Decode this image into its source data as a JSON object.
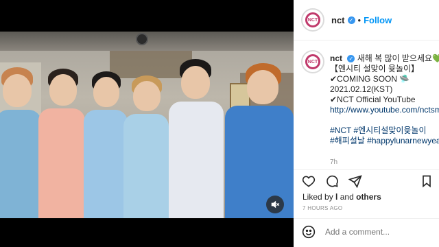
{
  "post": {
    "username": "nct",
    "avatar_text": "NCT",
    "follow_label": "Follow",
    "dot": "•",
    "verified_mark": "✓"
  },
  "caption": {
    "username": "nct",
    "lines": [
      "새해 복 많이 받으세요💚",
      "【엔시티 설맞이 윷놀이】",
      "✔COMING SOON 🛸",
      "2021.02.12(KST)",
      "✔NCT Official YouTube",
      "http://www.youtube.com/nctsmtown",
      "",
      "#NCT #엔시티설맞이윷놀이",
      "#해피설날 #happylunarnewyear"
    ],
    "time_short": "7h"
  },
  "engagement": {
    "liked_prefix": "Liked by",
    "liked_name": "l",
    "liked_suffix": "and",
    "liked_others": "others",
    "time_ago": "7 HOURS AGO"
  },
  "comment": {
    "placeholder": "Add a comment..."
  },
  "icons": {
    "mute": "speaker-muted-icon",
    "like": "heart-icon",
    "comment": "comment-bubble-icon",
    "share": "paper-plane-icon",
    "save": "bookmark-icon",
    "emoji": "smiley-icon"
  },
  "colors": {
    "follow_blue": "#0095f6",
    "verified_blue": "#3897f0",
    "link_navy": "#00376b"
  }
}
